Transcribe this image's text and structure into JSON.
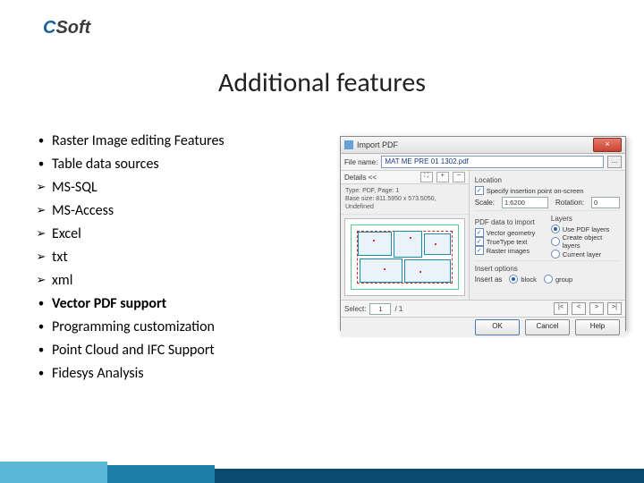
{
  "logo": {
    "c": "C",
    "soft": "Soft"
  },
  "title": "Additional features",
  "features": [
    {
      "marker": "•",
      "text": "Raster Image editing Features",
      "bold": false
    },
    {
      "marker": "•",
      "text": "Table data sources",
      "bold": false
    },
    {
      "marker": "➢",
      "text": "MS-SQL",
      "bold": false
    },
    {
      "marker": "➢",
      "text": "MS-Access",
      "bold": false
    },
    {
      "marker": "➢",
      "text": "Excel",
      "bold": false
    },
    {
      "marker": "➢",
      "text": "txt",
      "bold": false
    },
    {
      "marker": "➢",
      "text": "xml",
      "bold": false
    },
    {
      "marker": "•",
      "text": "Vector PDF support",
      "bold": true
    },
    {
      "marker": "•",
      "text": "Programming customization",
      "bold": false
    },
    {
      "marker": "•",
      "text": "Point Cloud and IFC Support",
      "bold": false
    },
    {
      "marker": "•",
      "text": "Fidesys Analysis",
      "bold": false
    }
  ],
  "dialog": {
    "title": "Import PDF",
    "close": "×",
    "fileLabel": "File name:",
    "fileValue": "MAT ME PRE 01 1302.pdf",
    "browse": "...",
    "detailsLabel": "Details <<",
    "meta1": "Type: PDF, Page: 1",
    "meta2": "Base size: 811.5950 x 573.5050, Undefined",
    "locationTitle": "Location",
    "specifyOnScreen": "Specify insertion point on-screen",
    "scaleLabel": "Scale:",
    "scaleValue": "1:6200",
    "rotLabel": "Rotation:",
    "rotValue": "0",
    "importTitle": "PDF data to import",
    "layersTitle": "Layers",
    "vecGeom": "Vector geometry",
    "ttText": "TrueType text",
    "rasterImg": "Raster images",
    "usePdfLayers": "Use PDF layers",
    "createObjLayers": "Create object layers",
    "currentLayer": "Current layer",
    "insertOptTitle": "Insert options",
    "insertAs": "Insert as",
    "optBlock": "block",
    "optGroup": "group",
    "navSelect": "Select:",
    "navPage": "1",
    "navTotal": "/ 1",
    "ok": "OK",
    "cancel": "Cancel",
    "help": "Help"
  }
}
